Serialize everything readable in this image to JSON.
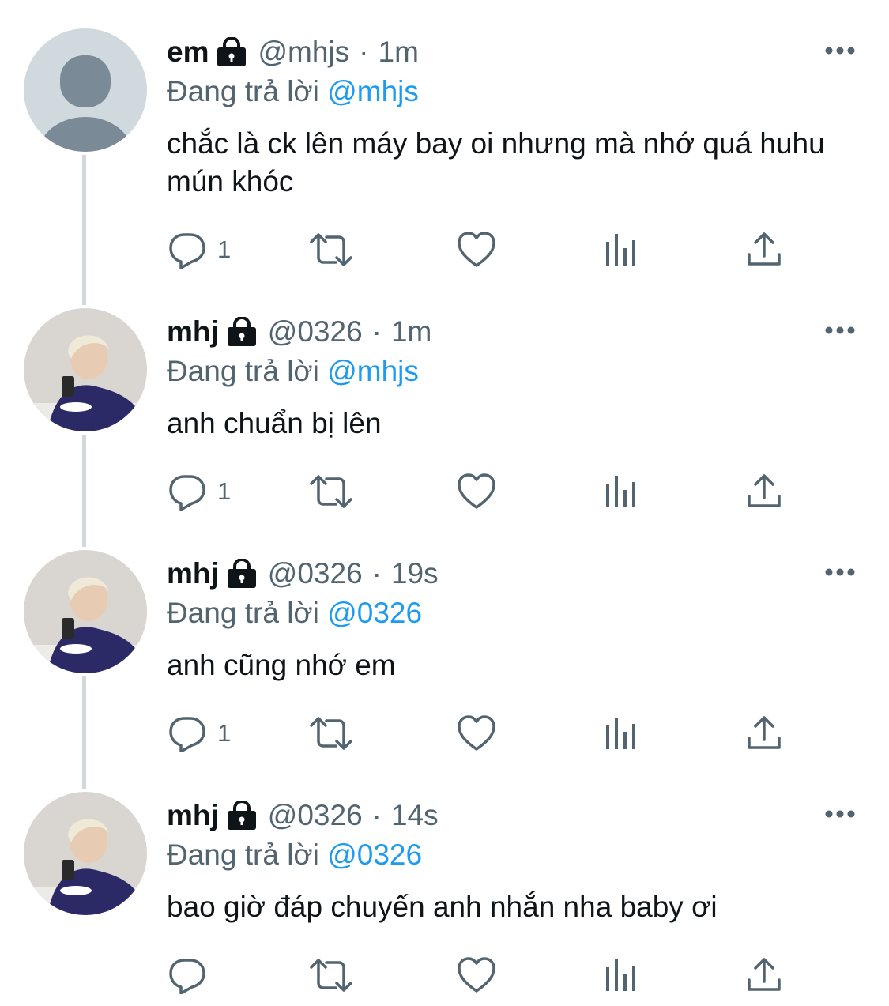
{
  "colors": {
    "accent": "#1d9bf0",
    "muted": "#536471",
    "text": "#0f1419",
    "thread": "#cfd9de"
  },
  "tweets": [
    {
      "display_name": "em",
      "handle": "@mhjs",
      "dot": "·",
      "time": "1m",
      "replying_label": "Đang trả lời",
      "replying_to": "@mhjs",
      "text": "chắc là ck lên máy bay oi nhưng mà nhớ quá huhu mún khóc",
      "reply_count": "1",
      "avatar": "default-avatar"
    },
    {
      "display_name": "mhj",
      "handle": "@0326",
      "dot": "·",
      "time": "1m",
      "replying_label": "Đang trả lời",
      "replying_to": "@mhjs",
      "text": "anh chuẩn bị lên",
      "reply_count": "1",
      "avatar": "profile-photo"
    },
    {
      "display_name": "mhj",
      "handle": "@0326",
      "dot": "·",
      "time": "19s",
      "replying_label": "Đang trả lời",
      "replying_to": "@0326",
      "text": "anh cũng nhớ em",
      "reply_count": "1",
      "avatar": "profile-photo"
    },
    {
      "display_name": "mhj",
      "handle": "@0326",
      "dot": "·",
      "time": "14s",
      "replying_label": "Đang trả lời",
      "replying_to": "@0326",
      "text": "bao giờ đáp chuyến anh nhắn nha baby ơi",
      "reply_count": "",
      "avatar": "profile-photo"
    }
  ],
  "icons": [
    "lock-icon",
    "more-icon",
    "reply-icon",
    "retweet-icon",
    "like-icon",
    "views-icon",
    "share-icon"
  ]
}
